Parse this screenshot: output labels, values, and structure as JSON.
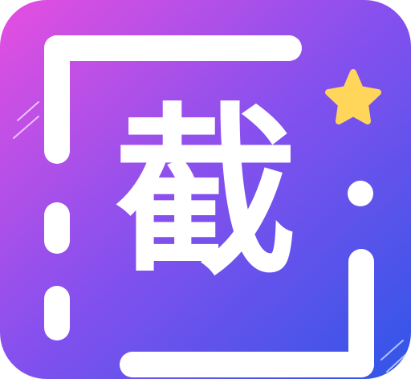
{
  "icon": {
    "glyph_text": "截",
    "gradient": {
      "start": "#e64fe0",
      "middle": "#8750ee",
      "end": "#2f56e8"
    },
    "frame_color": "#ffffff",
    "star_color": "#ffd55a",
    "decor_icons": [
      "viewfinder-corner-top-left-icon",
      "viewfinder-corner-bottom-right-icon",
      "star-icon",
      "sparkle-lines-icon",
      "dot-icon"
    ]
  }
}
